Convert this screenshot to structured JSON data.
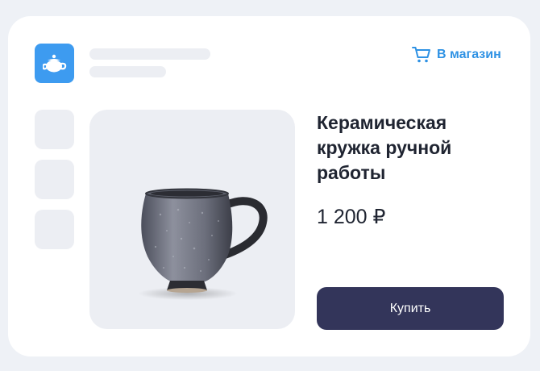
{
  "header": {
    "logo_icon": "teapot-icon",
    "shop_link": {
      "label": "В магазин",
      "icon": "cart-icon"
    }
  },
  "product": {
    "title": "Керамическая кружка ручной работы",
    "price": "1 200 ₽",
    "image_icon": "ceramic-mug-image"
  },
  "actions": {
    "buy_label": "Купить"
  },
  "colors": {
    "accent": "#3d9bf0",
    "link": "#2f92e4",
    "button": "#33355a",
    "placeholder": "#eceef3",
    "text": "#1f2431"
  }
}
